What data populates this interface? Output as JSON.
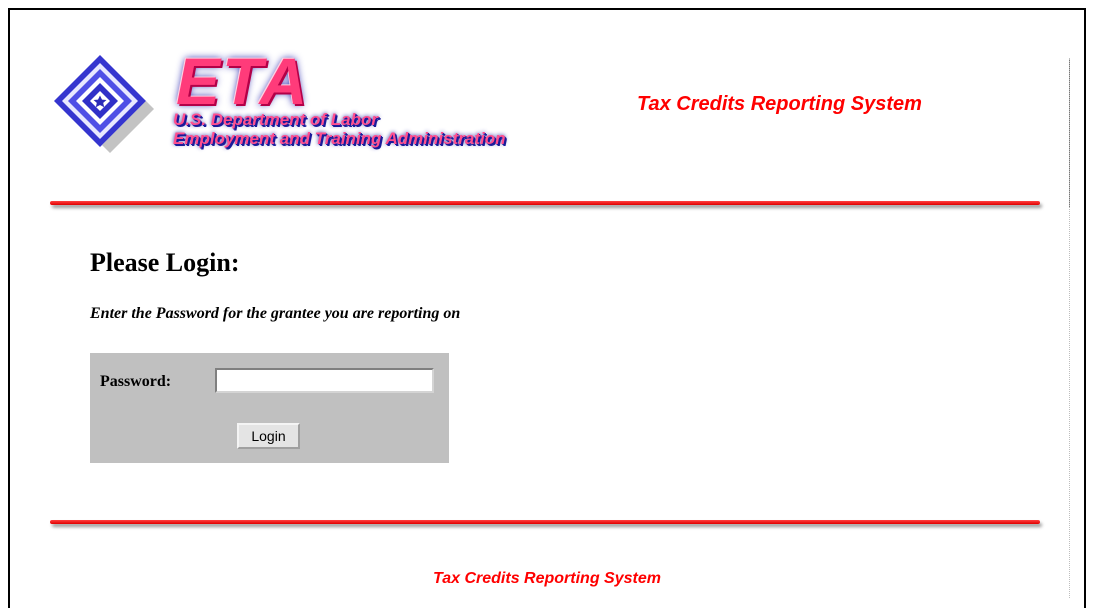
{
  "logo": {
    "wordmark": "ETA",
    "line1": "U.S. Department of Labor",
    "line2": "Employment and Training Administration",
    "colors": {
      "diamond": "#4a4ae0",
      "wordmark": "#ff3b7a",
      "outline": "#1b1b9a"
    }
  },
  "header": {
    "title": "Tax Credits Reporting System"
  },
  "login": {
    "title": "Please Login:",
    "instructions": "Enter the Password for the grantee you are reporting on",
    "password_label": "Password:",
    "password_value": "",
    "login_button": "Login"
  },
  "footer": {
    "title": "Tax Credits Reporting System"
  },
  "colors": {
    "accent_red": "#ff0000",
    "panel_gray": "#c0c0c0"
  }
}
